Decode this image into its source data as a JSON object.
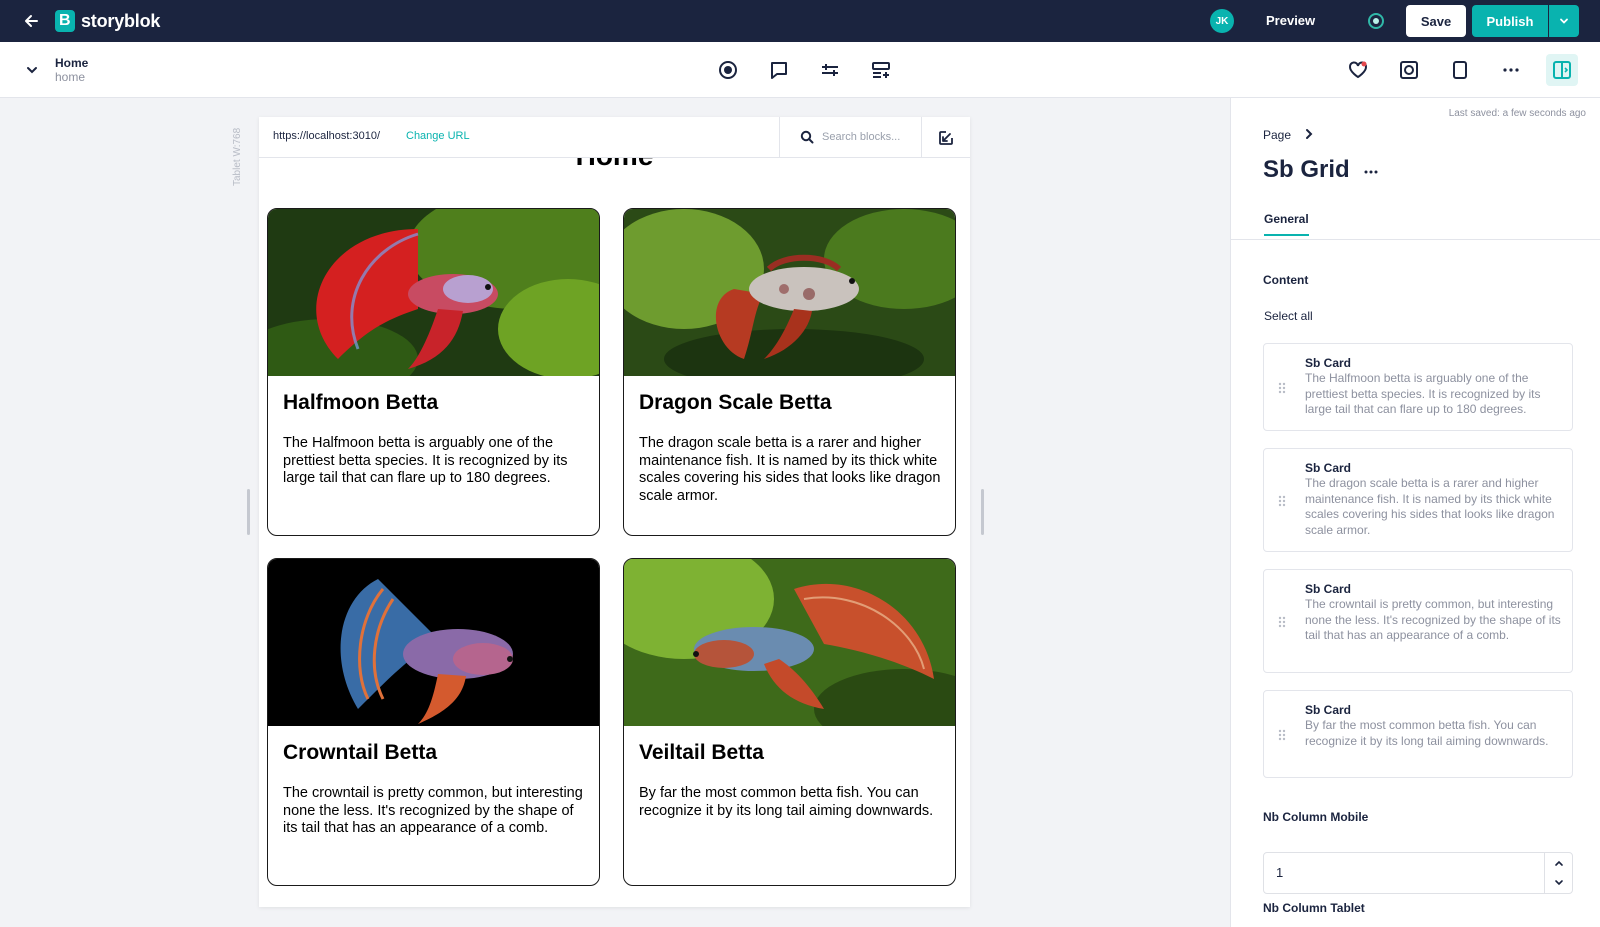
{
  "topbar": {
    "logo_text": "storyblok",
    "logo_letter": "B",
    "avatar_initials": "JK",
    "preview_label": "Preview",
    "save_label": "Save",
    "publish_label": "Publish",
    "brand_color": "#09b3af",
    "bar_color": "#1b243f"
  },
  "story": {
    "name": "Home",
    "slug": "home"
  },
  "toolbar": {
    "center_icons": [
      "target-icon",
      "comment-icon",
      "sliders-icon",
      "add-block-icon"
    ],
    "right_icons": [
      "heart-icon",
      "camera-icon",
      "tablet-icon",
      "more-icon",
      "sidebar-icon"
    ]
  },
  "canvas": {
    "device_label": "Tablet W:768",
    "url": "https://localhost:3010/",
    "change_url_label": "Change URL",
    "search_placeholder": "Search blocks...",
    "page_heading": "Home",
    "cards": [
      {
        "title": "Halfmoon Betta",
        "text": "The Halfmoon betta is arguably one of the prettiest betta species. It is recognized by its large tail that can flare up to 180 degrees."
      },
      {
        "title": "Dragon Scale Betta",
        "text": "The dragon scale betta is a rarer and higher maintenance fish. It is named by its thick white scales covering his sides that looks like dragon scale armor."
      },
      {
        "title": "Crowntail Betta",
        "text": "The crowntail is pretty common, but interesting none the less. It's recognized by the shape of its tail that has an appearance of a comb."
      },
      {
        "title": "Veiltail Betta",
        "text": "By far the most common betta fish. You can recognize it by its long tail aiming downwards."
      }
    ]
  },
  "panel": {
    "last_saved": "Last saved: a few seconds ago",
    "breadcrumb": "Page",
    "block_title": "Sb Grid",
    "tab_general": "General",
    "content_label": "Content",
    "select_all": "Select all",
    "nested_blocks": [
      {
        "title": "Sb Card",
        "desc": "The Halfmoon betta is arguably one of the prettiest betta species. It is recognized by its large tail that can flare up to 180 degrees."
      },
      {
        "title": "Sb Card",
        "desc": "The dragon scale betta is a rarer and higher maintenance fish. It is named by its thick white scales covering his sides that looks like dragon scale armor."
      },
      {
        "title": "Sb Card",
        "desc": "The crowntail is pretty common, but interesting none the less. It's recognized by the shape of its tail that has an appearance of a comb."
      },
      {
        "title": "Sb Card",
        "desc": "By far the most common betta fish. You can recognize it by its long tail aiming downwards."
      }
    ],
    "nb_column_mobile_label": "Nb Column Mobile",
    "nb_column_mobile_value": "1",
    "nb_column_tablet_label": "Nb Column Tablet"
  }
}
